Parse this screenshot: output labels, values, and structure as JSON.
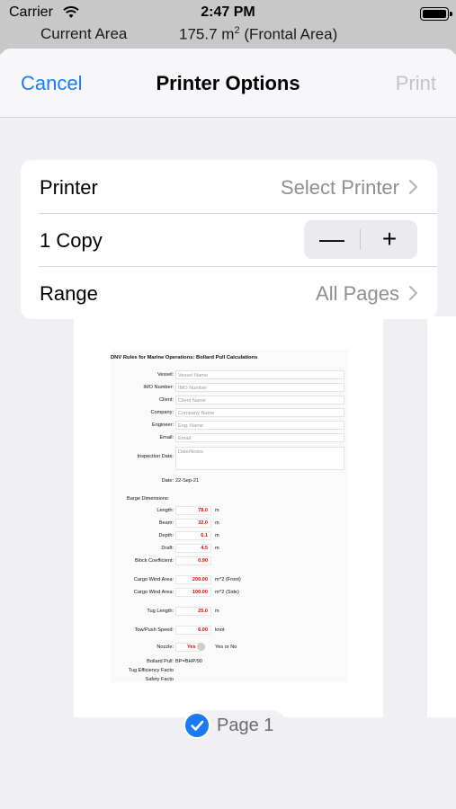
{
  "status_bar": {
    "carrier": "Carrier",
    "time": "2:47 PM"
  },
  "background": {
    "label": "Current Area",
    "value": "175.7",
    "unit": "m",
    "unit_exp": "2",
    "suffix": "(Frontal Area)"
  },
  "navbar": {
    "cancel": "Cancel",
    "title": "Printer Options",
    "print": "Print"
  },
  "options": {
    "printer": {
      "label": "Printer",
      "value": "Select Printer"
    },
    "copies": {
      "label": "1 Copy",
      "minus": "—",
      "plus": "+"
    },
    "range": {
      "label": "Range",
      "value": "All Pages"
    }
  },
  "preview": {
    "page_label": "Page 1",
    "doc_title": "DNV Rules for Marine Operations: Bollard Pull Calculations",
    "fields": [
      {
        "label": "Vessel:",
        "placeholder": "Vessel Name"
      },
      {
        "label": "IMO Number:",
        "placeholder": "IMO Number"
      },
      {
        "label": "Client:",
        "placeholder": "Client Name"
      },
      {
        "label": "Company:",
        "placeholder": "Company Name"
      },
      {
        "label": "Engineer:",
        "placeholder": "Eng. Name"
      },
      {
        "label": "Email:",
        "placeholder": "Email"
      },
      {
        "label": "Inspection Date:",
        "placeholder": "Date/Notes"
      }
    ],
    "date": {
      "label": "Date:",
      "value": "22-Sep-21"
    },
    "barge_heading": "Barge Dimensions:",
    "dims": [
      {
        "label": "Length:",
        "value": "78.0",
        "unit": "m"
      },
      {
        "label": "Beam:",
        "value": "32.0",
        "unit": "m"
      },
      {
        "label": "Depth:",
        "value": "6.1",
        "unit": "m"
      },
      {
        "label": "Draft:",
        "value": "4.5",
        "unit": "m"
      },
      {
        "label": "Block Coefficient:",
        "value": "0.90",
        "unit": ""
      }
    ],
    "wind": [
      {
        "label": "Cargo Wind Area:",
        "value": "200.00",
        "unit": "m^2 (Front)"
      },
      {
        "label": "Cargo Wind Area:",
        "value": "100.00",
        "unit": "m^2 (Side)"
      }
    ],
    "tug_length": {
      "label": "Tug Length:",
      "value": "25.0",
      "unit": "m"
    },
    "tow_speed": {
      "label": "Tow/Push Speed:",
      "value": "6.00",
      "unit": "knot"
    },
    "nozzle": {
      "label": "Nozzle:",
      "value": "Yes",
      "unit": "Yes or No"
    },
    "bollard": {
      "label": "Bollard Pull:",
      "value": "BP=BHP/90"
    },
    "tug_eff": {
      "label": "Tug Efficiency Facto"
    },
    "safety": {
      "label": "Safety Facto"
    }
  }
}
